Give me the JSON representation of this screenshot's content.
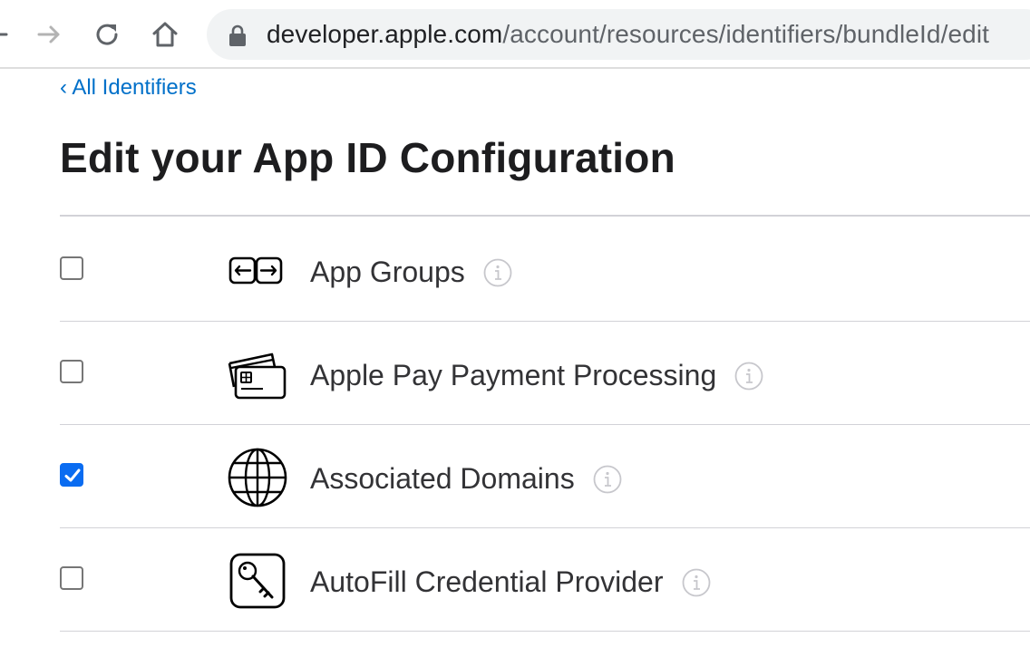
{
  "browser": {
    "url_host": "developer.apple.com",
    "url_path": "/account/resources/identifiers/bundleId/edit"
  },
  "page": {
    "back_link": "‹ All Identifiers",
    "title": "Edit your App ID Configuration"
  },
  "capabilities": [
    {
      "name": "App Groups",
      "checked": false,
      "icon": "app-groups-icon"
    },
    {
      "name": "Apple Pay Payment Processing",
      "checked": false,
      "icon": "apple-pay-cards-icon"
    },
    {
      "name": "Associated Domains",
      "checked": true,
      "icon": "globe-icon"
    },
    {
      "name": "AutoFill Credential Provider",
      "checked": false,
      "icon": "key-icon"
    }
  ],
  "colors": {
    "link": "#0070c9",
    "checkbox_checked": "#0a6cf1"
  }
}
